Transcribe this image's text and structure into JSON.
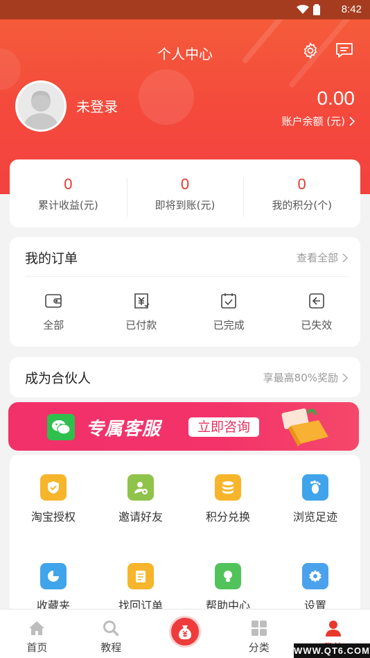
{
  "status_bar": {
    "time": "8:42"
  },
  "header": {
    "title": "个人中心"
  },
  "profile": {
    "login_text": "未登录",
    "balance_value": "0.00",
    "balance_label": "账户余额 (元)"
  },
  "stats": [
    {
      "value": "0",
      "label": "累计收益(元)"
    },
    {
      "value": "0",
      "label": "即将到账(元)"
    },
    {
      "value": "0",
      "label": "我的积分(个)"
    }
  ],
  "orders": {
    "title": "我的订单",
    "view_all": "查看全部",
    "items": [
      {
        "label": "全部",
        "icon": "wallet-icon"
      },
      {
        "label": "已付款",
        "icon": "paid-icon"
      },
      {
        "label": "已完成",
        "icon": "completed-icon"
      },
      {
        "label": "已失效",
        "icon": "expired-icon"
      }
    ]
  },
  "partner": {
    "title": "成为合伙人",
    "reward": "享最高80%奖励"
  },
  "banner": {
    "title": "专属客服",
    "button": "立即咨询"
  },
  "tools": [
    {
      "label": "淘宝授权",
      "icon": "shield-check-icon",
      "color": "#f7b52b"
    },
    {
      "label": "邀请好友",
      "icon": "add-user-icon",
      "color": "#8fc34a"
    },
    {
      "label": "积分兑换",
      "icon": "coins-icon",
      "color": "#f7b52b"
    },
    {
      "label": "浏览足迹",
      "icon": "footprint-icon",
      "color": "#3fa4ea"
    },
    {
      "label": "收藏夹",
      "icon": "pie-chart-icon",
      "color": "#3fa4ea"
    },
    {
      "label": "找回订单",
      "icon": "order-icon",
      "color": "#f7b52b"
    },
    {
      "label": "帮助中心",
      "icon": "lightbulb-icon",
      "color": "#52c35b"
    },
    {
      "label": "设置",
      "icon": "settings-icon",
      "color": "#4aa2ec"
    }
  ],
  "tabbar": [
    {
      "label": "首页",
      "icon": "home-icon"
    },
    {
      "label": "教程",
      "icon": "search-icon"
    },
    {
      "label": "",
      "icon": "money-bag-icon"
    },
    {
      "label": "分类",
      "icon": "grid-icon"
    },
    {
      "label": "我的",
      "icon": "user-icon"
    }
  ],
  "watermark": "WWW.QT6.COM",
  "colors": {
    "accent": "#e8382b",
    "header_bg": "#f44a3c",
    "banner_bg": "#f2306a"
  }
}
